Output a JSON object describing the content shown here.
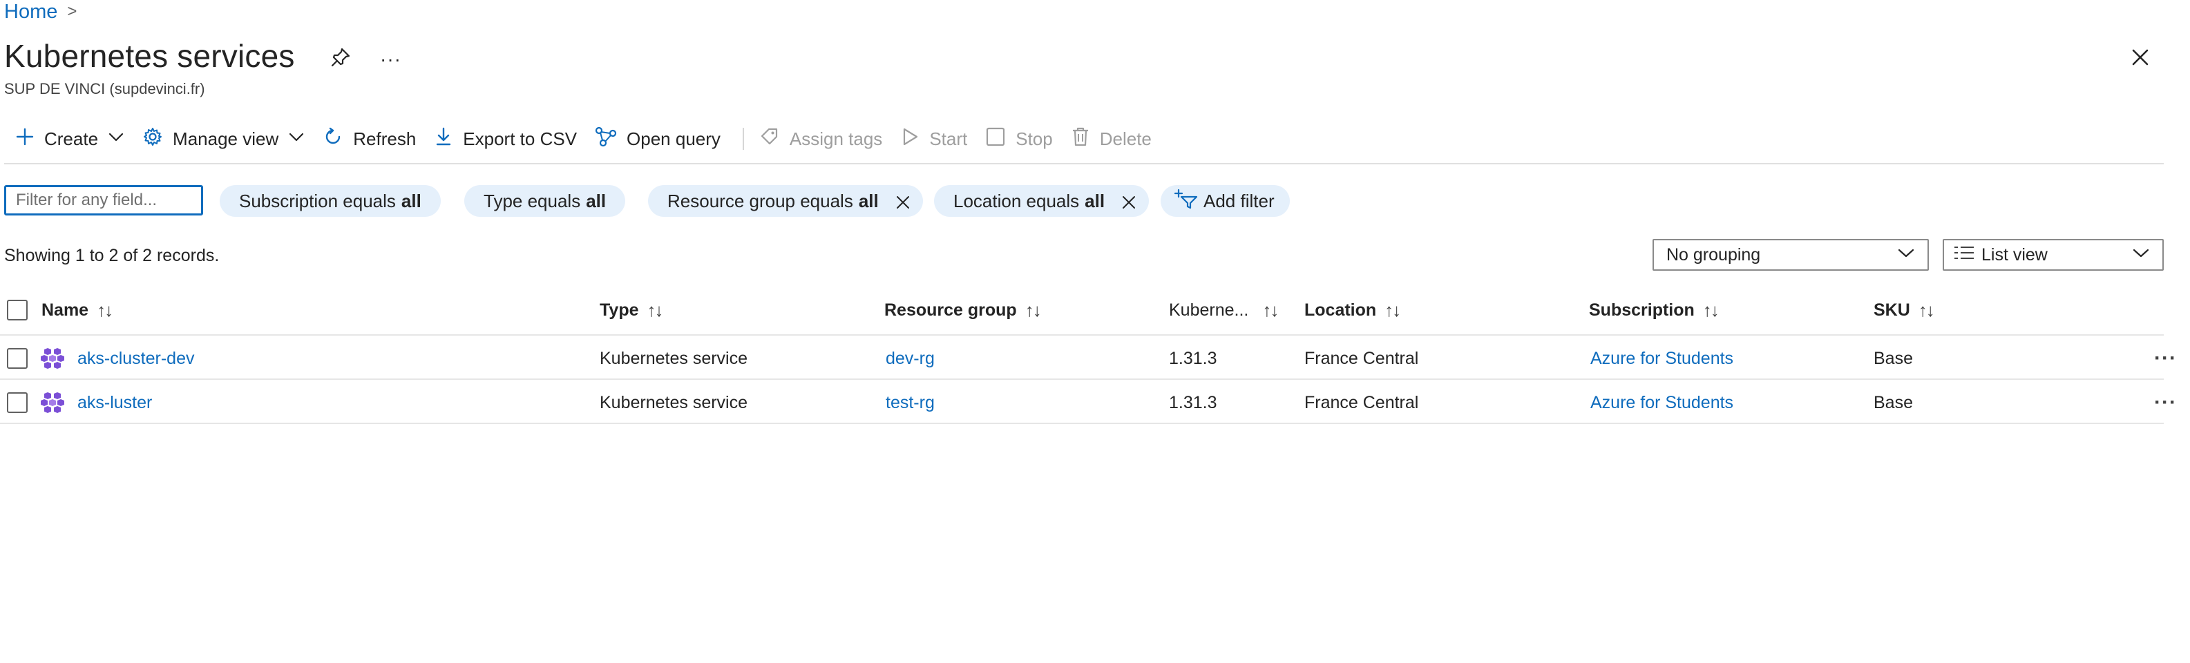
{
  "breadcrumb": {
    "home": "Home",
    "separator": ">"
  },
  "header": {
    "title": "Kubernetes services",
    "more": "···",
    "subtitle": "SUP DE VINCI (supdevinci.fr)"
  },
  "toolbar": {
    "create": "Create",
    "manage_view": "Manage view",
    "refresh": "Refresh",
    "export_csv": "Export to CSV",
    "open_query": "Open query",
    "assign_tags": "Assign tags",
    "start": "Start",
    "stop": "Stop",
    "delete": "Delete"
  },
  "filters": {
    "placeholder": "Filter for any field...",
    "subscription": {
      "label": "Subscription equals",
      "value": "all"
    },
    "type": {
      "label": "Type equals",
      "value": "all"
    },
    "resource_group": {
      "label": "Resource group equals",
      "value": "all"
    },
    "location": {
      "label": "Location equals",
      "value": "all"
    },
    "add_filter": "Add filter"
  },
  "records_text": "Showing 1 to 2 of 2 records.",
  "grouping": {
    "selected": "No grouping"
  },
  "view": {
    "selected": "List view"
  },
  "table": {
    "columns": {
      "name": "Name",
      "type": "Type",
      "resource_group": "Resource group",
      "kubernetes": "Kuberne...",
      "location": "Location",
      "subscription": "Subscription",
      "sku": "SKU",
      "sort": "↑↓"
    },
    "rows": [
      {
        "name": "aks-cluster-dev",
        "type": "Kubernetes service",
        "resource_group": "dev-rg",
        "kubernetes": "1.31.3",
        "location": "France Central",
        "subscription": "Azure for Students",
        "sku": "Base",
        "more": "···"
      },
      {
        "name": "aks-luster",
        "type": "Kubernetes service",
        "resource_group": "test-rg",
        "kubernetes": "1.31.3",
        "location": "France Central",
        "subscription": "Azure for Students",
        "sku": "Base",
        "more": "···"
      }
    ]
  },
  "colors": {
    "accent": "#0f6cbd",
    "pill_bg": "#e5f0fb",
    "aks_icon": "#7b4fd6"
  },
  "icons": [
    "chevron-right-icon",
    "pin-icon",
    "close-icon",
    "plus-icon",
    "chevron-down-icon",
    "gear-icon",
    "refresh-icon",
    "download-icon",
    "query-icon",
    "tag-icon",
    "play-icon",
    "stop-icon",
    "trash-icon",
    "filter-add-icon",
    "list-icon",
    "kubernetes-icon"
  ]
}
